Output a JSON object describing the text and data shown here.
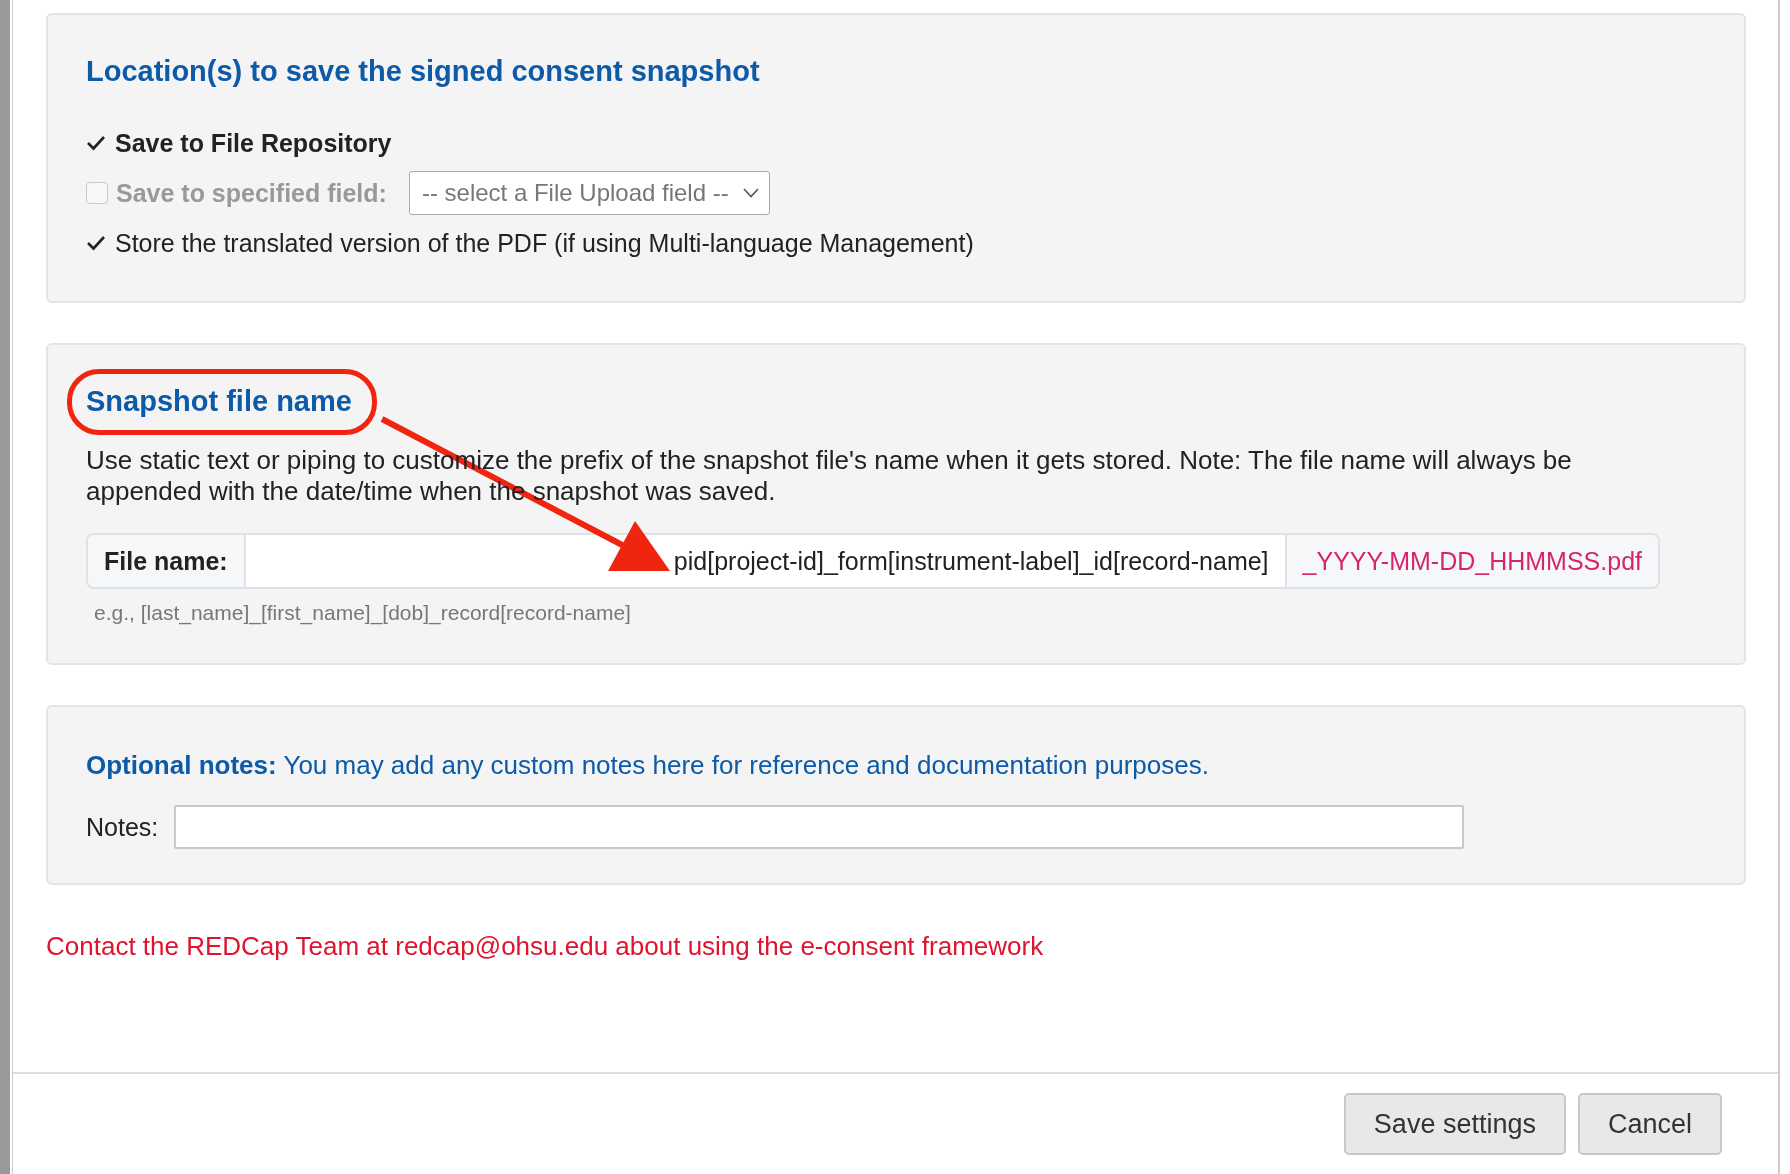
{
  "location_panel": {
    "title": "Location(s) to save the signed consent snapshot",
    "options": [
      {
        "label": "Save to File Repository",
        "checked": true,
        "disabled": false,
        "bold": true
      },
      {
        "label": "Save to specified field:",
        "checked": false,
        "disabled": true,
        "bold": true,
        "select": {
          "value": "-- select a File Upload field --"
        }
      },
      {
        "label": "Store the translated version of the PDF (if using Multi-language Management)",
        "checked": true,
        "disabled": false,
        "bold": false
      }
    ]
  },
  "filename_panel": {
    "title": "Snapshot file name",
    "highlighted": true,
    "description": "Use static text or piping to customize the prefix of the snapshot file's name when it gets stored. Note: The file name will always be appended with the date/time when the snapshot was saved.",
    "field_label": "File name:",
    "value": "pid[project-id]_form[instrument-label]_id[record-name]",
    "suffix": "_YYYY-MM-DD_HHMMSS.pdf",
    "example": "e.g., [last_name]_[first_name]_[dob]_record[record-name]"
  },
  "notes_panel": {
    "intro": "**Optional notes:** You may add any custom notes here for reference and documentation purposes.",
    "field_label": "Notes:"
  },
  "contact_text": "Contact the REDCap Team at redcap@ohsu.edu about using the e-consent framework",
  "buttons": [
    "Save settings",
    "Cancel"
  ]
}
